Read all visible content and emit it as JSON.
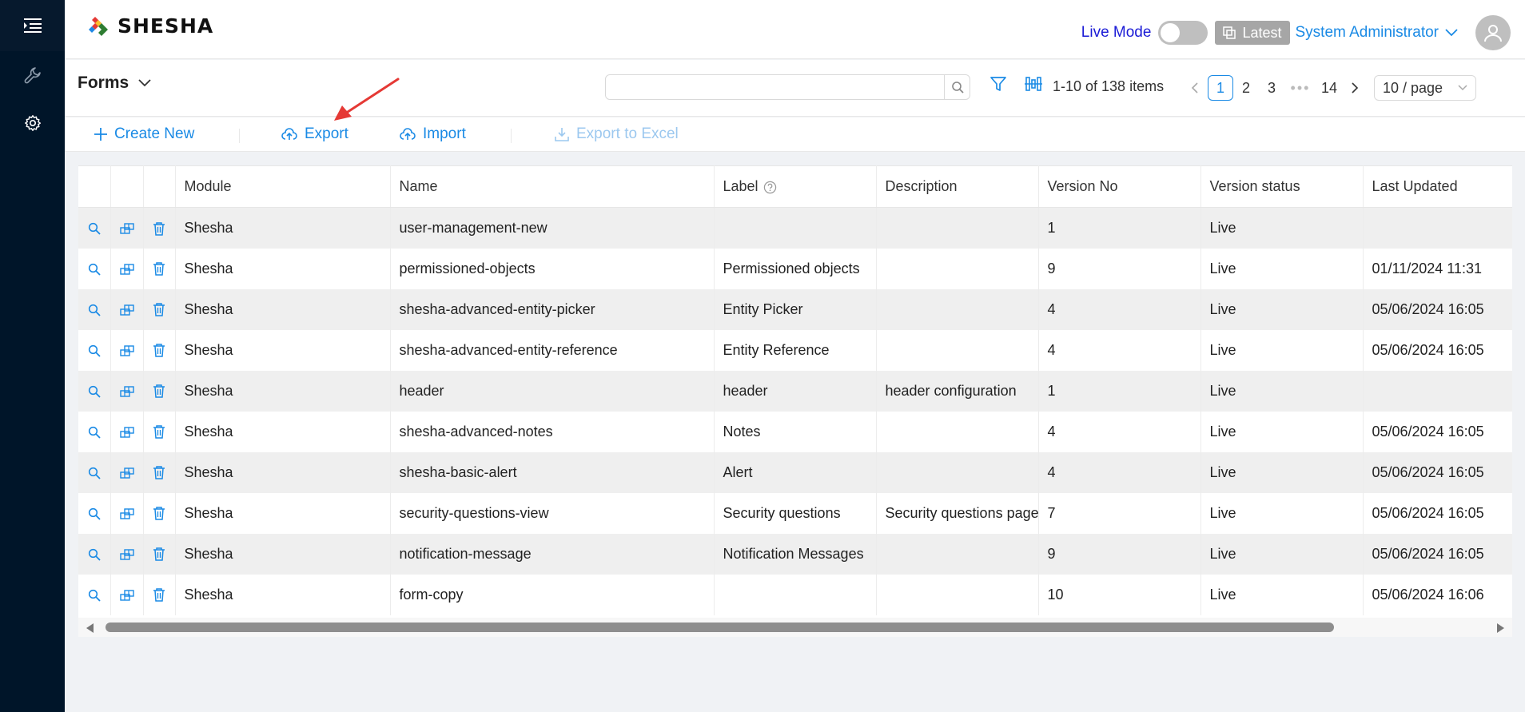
{
  "brand": {
    "name": "SHESHA"
  },
  "header": {
    "live_mode_label": "Live Mode",
    "latest_label": "Latest",
    "user_name": "System Administrator"
  },
  "page": {
    "title": "Forms",
    "search": {
      "value": "",
      "placeholder": ""
    },
    "page_info": "1-10 of 138 items",
    "pagination": {
      "pages": [
        "1",
        "2",
        "3",
        "14"
      ],
      "current": "1",
      "page_size": "10 / page"
    }
  },
  "toolbar": {
    "create_new": "Create New",
    "export": "Export",
    "import": "Import",
    "export_excel": "Export to Excel"
  },
  "table": {
    "columns": [
      "Module",
      "Name",
      "Label",
      "Description",
      "Version No",
      "Version status",
      "Last Updated"
    ],
    "rows": [
      [
        "Shesha",
        "user-management-new",
        "",
        "",
        "1",
        "Live",
        ""
      ],
      [
        "Shesha",
        "permissioned-objects",
        "Permissioned objects",
        "",
        "9",
        "Live",
        "01/11/2024 11:31"
      ],
      [
        "Shesha",
        "shesha-advanced-entity-picker",
        "Entity Picker",
        "",
        "4",
        "Live",
        "05/06/2024 16:05"
      ],
      [
        "Shesha",
        "shesha-advanced-entity-reference",
        "Entity Reference",
        "",
        "4",
        "Live",
        "05/06/2024 16:05"
      ],
      [
        "Shesha",
        "header",
        "header",
        "header configuration",
        "1",
        "Live",
        ""
      ],
      [
        "Shesha",
        "shesha-advanced-notes",
        "Notes",
        "",
        "4",
        "Live",
        "05/06/2024 16:05"
      ],
      [
        "Shesha",
        "shesha-basic-alert",
        "Alert",
        "",
        "4",
        "Live",
        "05/06/2024 16:05"
      ],
      [
        "Shesha",
        "security-questions-view",
        "Security questions",
        "Security questions page",
        "7",
        "Live",
        "05/06/2024 16:05"
      ],
      [
        "Shesha",
        "notification-message",
        "Notification Messages",
        "",
        "9",
        "Live",
        "05/06/2024 16:05"
      ],
      [
        "Shesha",
        "form-copy",
        "",
        "",
        "10",
        "Live",
        "05/06/2024 16:06"
      ]
    ]
  },
  "colors": {
    "accent": "#1a8ae5",
    "sidebar": "#001529",
    "annotation": "#e53935"
  },
  "icons": [
    "menu-icon",
    "wrench-icon",
    "gear-icon",
    "search-icon",
    "filter-icon",
    "columns-icon",
    "reload-icon",
    "plus-icon",
    "cloud-upload-icon",
    "download-icon",
    "view-icon",
    "copy-icon",
    "delete-icon",
    "question-icon"
  ]
}
